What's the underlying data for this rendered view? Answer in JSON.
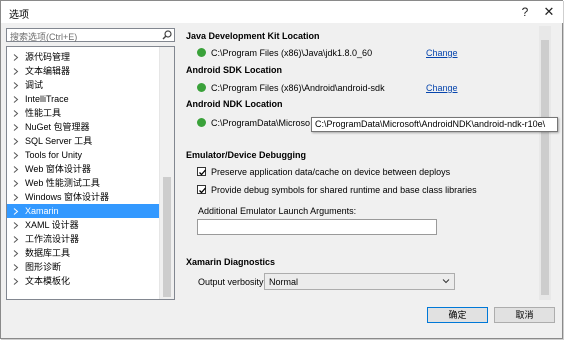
{
  "window": {
    "title": "选项",
    "help": "?",
    "close": "✕"
  },
  "search": {
    "placeholder": "搜索选项(Ctrl+E)"
  },
  "tree": {
    "items": [
      "源代码管理",
      "文本编辑器",
      "调试",
      "IntelliTrace",
      "性能工具",
      "NuGet 包管理器",
      "SQL Server 工具",
      "Tools for Unity",
      "Web 窗体设计器",
      "Web 性能测试工具",
      "Windows 窗体设计器",
      "Xamarin",
      "XAML 设计器",
      "工作流设计器",
      "数据库工具",
      "图形诊断",
      "文本模板化"
    ],
    "selected": "Xamarin"
  },
  "jdk": {
    "heading": "Java Development Kit Location",
    "path": "C:\\Program Files (x86)\\Java\\jdk1.8.0_60",
    "change": "Change"
  },
  "sdk": {
    "heading": "Android SDK Location",
    "path": "C:\\Program Files (x86)\\Android\\android-sdk",
    "change": "Change"
  },
  "ndk": {
    "heading": "Android NDK Location",
    "path": "C:\\ProgramData\\Microso"
  },
  "tooltip": "C:\\ProgramData\\Microsoft\\AndroidNDK\\android-ndk-r10e\\",
  "emulator": {
    "heading": "Emulator/Device Debugging",
    "opt1": "Preserve application data/cache on device between deploys",
    "opt2": "Provide debug symbols for shared runtime and base class libraries",
    "args_label": "Additional Emulator Launch Arguments:",
    "args_value": ""
  },
  "diagnostics": {
    "heading": "Xamarin Diagnostics",
    "verbosity_label": "Output verbosity:",
    "verbosity_value": "Normal"
  },
  "buttons": {
    "ok": "确定",
    "cancel": "取消"
  },
  "colors": {
    "selection": "#3399ff",
    "link": "#0645ad",
    "ok_green": "#3aa13a"
  }
}
